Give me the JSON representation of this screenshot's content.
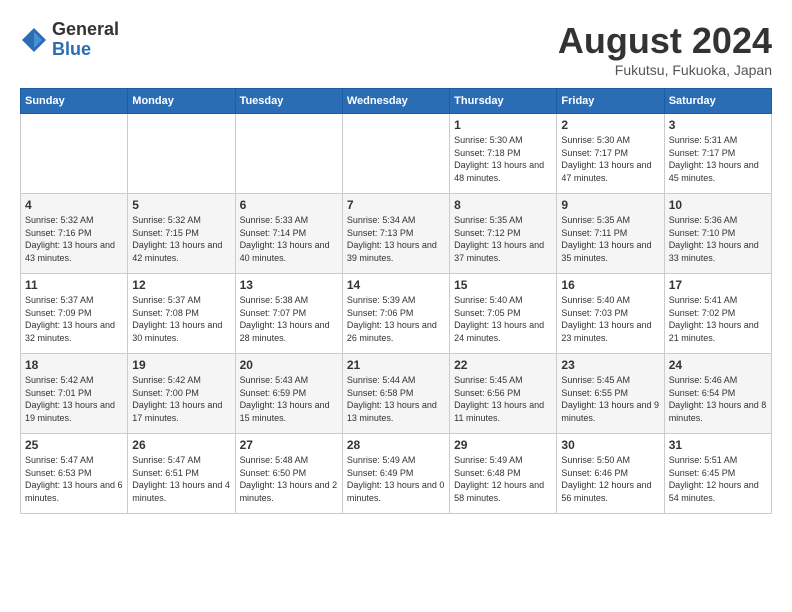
{
  "header": {
    "logo_general": "General",
    "logo_blue": "Blue",
    "title": "August 2024",
    "subtitle": "Fukutsu, Fukuoka, Japan"
  },
  "weekdays": [
    "Sunday",
    "Monday",
    "Tuesday",
    "Wednesday",
    "Thursday",
    "Friday",
    "Saturday"
  ],
  "weeks": [
    [
      {
        "day": "",
        "sunrise": "",
        "sunset": "",
        "daylight": ""
      },
      {
        "day": "",
        "sunrise": "",
        "sunset": "",
        "daylight": ""
      },
      {
        "day": "",
        "sunrise": "",
        "sunset": "",
        "daylight": ""
      },
      {
        "day": "",
        "sunrise": "",
        "sunset": "",
        "daylight": ""
      },
      {
        "day": "1",
        "sunrise": "Sunrise: 5:30 AM",
        "sunset": "Sunset: 7:18 PM",
        "daylight": "Daylight: 13 hours and 48 minutes."
      },
      {
        "day": "2",
        "sunrise": "Sunrise: 5:30 AM",
        "sunset": "Sunset: 7:17 PM",
        "daylight": "Daylight: 13 hours and 47 minutes."
      },
      {
        "day": "3",
        "sunrise": "Sunrise: 5:31 AM",
        "sunset": "Sunset: 7:17 PM",
        "daylight": "Daylight: 13 hours and 45 minutes."
      }
    ],
    [
      {
        "day": "4",
        "sunrise": "Sunrise: 5:32 AM",
        "sunset": "Sunset: 7:16 PM",
        "daylight": "Daylight: 13 hours and 43 minutes."
      },
      {
        "day": "5",
        "sunrise": "Sunrise: 5:32 AM",
        "sunset": "Sunset: 7:15 PM",
        "daylight": "Daylight: 13 hours and 42 minutes."
      },
      {
        "day": "6",
        "sunrise": "Sunrise: 5:33 AM",
        "sunset": "Sunset: 7:14 PM",
        "daylight": "Daylight: 13 hours and 40 minutes."
      },
      {
        "day": "7",
        "sunrise": "Sunrise: 5:34 AM",
        "sunset": "Sunset: 7:13 PM",
        "daylight": "Daylight: 13 hours and 39 minutes."
      },
      {
        "day": "8",
        "sunrise": "Sunrise: 5:35 AM",
        "sunset": "Sunset: 7:12 PM",
        "daylight": "Daylight: 13 hours and 37 minutes."
      },
      {
        "day": "9",
        "sunrise": "Sunrise: 5:35 AM",
        "sunset": "Sunset: 7:11 PM",
        "daylight": "Daylight: 13 hours and 35 minutes."
      },
      {
        "day": "10",
        "sunrise": "Sunrise: 5:36 AM",
        "sunset": "Sunset: 7:10 PM",
        "daylight": "Daylight: 13 hours and 33 minutes."
      }
    ],
    [
      {
        "day": "11",
        "sunrise": "Sunrise: 5:37 AM",
        "sunset": "Sunset: 7:09 PM",
        "daylight": "Daylight: 13 hours and 32 minutes."
      },
      {
        "day": "12",
        "sunrise": "Sunrise: 5:37 AM",
        "sunset": "Sunset: 7:08 PM",
        "daylight": "Daylight: 13 hours and 30 minutes."
      },
      {
        "day": "13",
        "sunrise": "Sunrise: 5:38 AM",
        "sunset": "Sunset: 7:07 PM",
        "daylight": "Daylight: 13 hours and 28 minutes."
      },
      {
        "day": "14",
        "sunrise": "Sunrise: 5:39 AM",
        "sunset": "Sunset: 7:06 PM",
        "daylight": "Daylight: 13 hours and 26 minutes."
      },
      {
        "day": "15",
        "sunrise": "Sunrise: 5:40 AM",
        "sunset": "Sunset: 7:05 PM",
        "daylight": "Daylight: 13 hours and 24 minutes."
      },
      {
        "day": "16",
        "sunrise": "Sunrise: 5:40 AM",
        "sunset": "Sunset: 7:03 PM",
        "daylight": "Daylight: 13 hours and 23 minutes."
      },
      {
        "day": "17",
        "sunrise": "Sunrise: 5:41 AM",
        "sunset": "Sunset: 7:02 PM",
        "daylight": "Daylight: 13 hours and 21 minutes."
      }
    ],
    [
      {
        "day": "18",
        "sunrise": "Sunrise: 5:42 AM",
        "sunset": "Sunset: 7:01 PM",
        "daylight": "Daylight: 13 hours and 19 minutes."
      },
      {
        "day": "19",
        "sunrise": "Sunrise: 5:42 AM",
        "sunset": "Sunset: 7:00 PM",
        "daylight": "Daylight: 13 hours and 17 minutes."
      },
      {
        "day": "20",
        "sunrise": "Sunrise: 5:43 AM",
        "sunset": "Sunset: 6:59 PM",
        "daylight": "Daylight: 13 hours and 15 minutes."
      },
      {
        "day": "21",
        "sunrise": "Sunrise: 5:44 AM",
        "sunset": "Sunset: 6:58 PM",
        "daylight": "Daylight: 13 hours and 13 minutes."
      },
      {
        "day": "22",
        "sunrise": "Sunrise: 5:45 AM",
        "sunset": "Sunset: 6:56 PM",
        "daylight": "Daylight: 13 hours and 11 minutes."
      },
      {
        "day": "23",
        "sunrise": "Sunrise: 5:45 AM",
        "sunset": "Sunset: 6:55 PM",
        "daylight": "Daylight: 13 hours and 9 minutes."
      },
      {
        "day": "24",
        "sunrise": "Sunrise: 5:46 AM",
        "sunset": "Sunset: 6:54 PM",
        "daylight": "Daylight: 13 hours and 8 minutes."
      }
    ],
    [
      {
        "day": "25",
        "sunrise": "Sunrise: 5:47 AM",
        "sunset": "Sunset: 6:53 PM",
        "daylight": "Daylight: 13 hours and 6 minutes."
      },
      {
        "day": "26",
        "sunrise": "Sunrise: 5:47 AM",
        "sunset": "Sunset: 6:51 PM",
        "daylight": "Daylight: 13 hours and 4 minutes."
      },
      {
        "day": "27",
        "sunrise": "Sunrise: 5:48 AM",
        "sunset": "Sunset: 6:50 PM",
        "daylight": "Daylight: 13 hours and 2 minutes."
      },
      {
        "day": "28",
        "sunrise": "Sunrise: 5:49 AM",
        "sunset": "Sunset: 6:49 PM",
        "daylight": "Daylight: 13 hours and 0 minutes."
      },
      {
        "day": "29",
        "sunrise": "Sunrise: 5:49 AM",
        "sunset": "Sunset: 6:48 PM",
        "daylight": "Daylight: 12 hours and 58 minutes."
      },
      {
        "day": "30",
        "sunrise": "Sunrise: 5:50 AM",
        "sunset": "Sunset: 6:46 PM",
        "daylight": "Daylight: 12 hours and 56 minutes."
      },
      {
        "day": "31",
        "sunrise": "Sunrise: 5:51 AM",
        "sunset": "Sunset: 6:45 PM",
        "daylight": "Daylight: 12 hours and 54 minutes."
      }
    ]
  ]
}
